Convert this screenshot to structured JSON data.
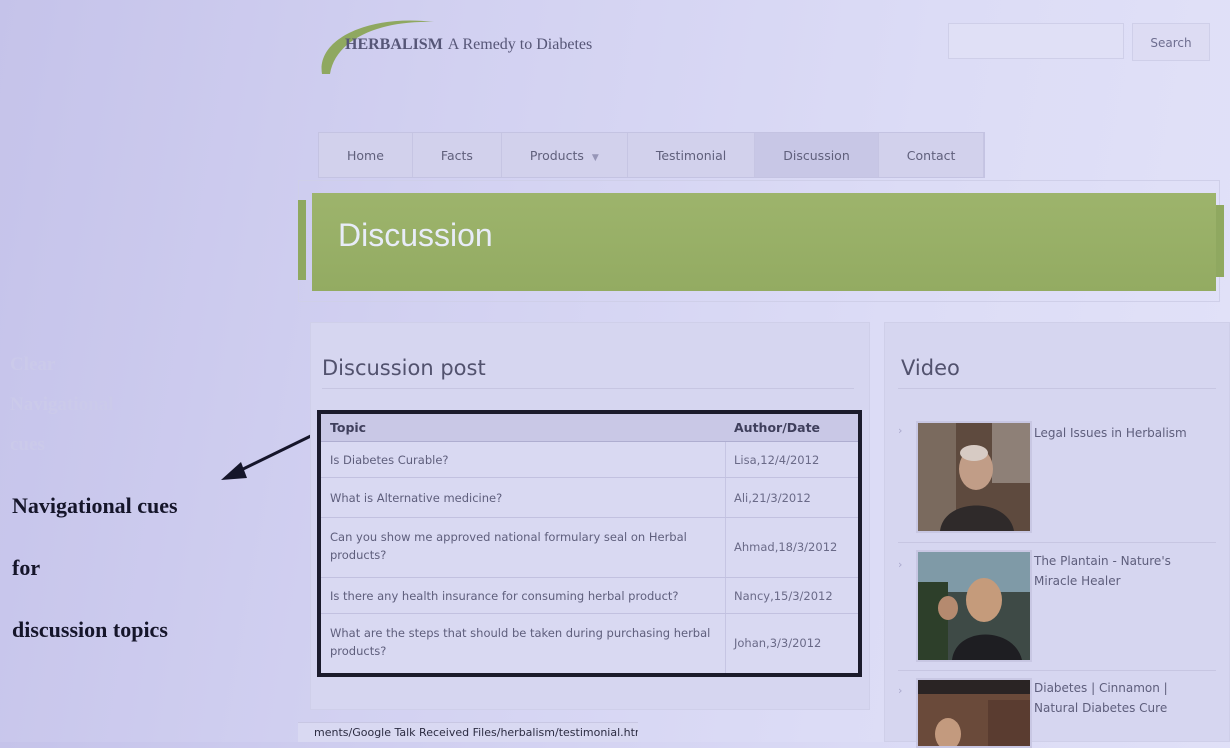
{
  "annotation": {
    "faint_lines": [
      "Clear",
      "Navigational",
      "cues"
    ],
    "cue_lines": [
      "Navigational cues",
      "for",
      "discussion topics"
    ]
  },
  "site": {
    "brand_name": "HERBALISM",
    "brand_tagline": "A Remedy to Diabetes",
    "search": {
      "placeholder": "",
      "button_label": "Search"
    },
    "nav": {
      "items": [
        {
          "label": "Home"
        },
        {
          "label": "Facts"
        },
        {
          "label": "Products"
        },
        {
          "label": "Testimonial"
        },
        {
          "label": "Discussion"
        },
        {
          "label": "Contact"
        }
      ]
    },
    "banner_title": "Discussion",
    "main": {
      "heading": "Discussion post",
      "table": {
        "headers": {
          "topic": "Topic",
          "author": "Author/Date"
        },
        "rows": [
          {
            "topic": "Is Diabetes Curable?",
            "author": "Lisa,12/4/2012"
          },
          {
            "topic": "What is Alternative medicine?",
            "author": "Ali,21/3/2012"
          },
          {
            "topic": "Can you show me approved national formulary seal on Herbal products?",
            "author": "Ahmad,18/3/2012"
          },
          {
            "topic": "Is there any health insurance for consuming herbal product?",
            "author": "Nancy,15/3/2012"
          },
          {
            "topic": "What are the steps that should be taken during purchasing herbal products?",
            "author": "Johan,3/3/2012"
          }
        ]
      }
    },
    "sidebar": {
      "heading": "Video",
      "videos": [
        {
          "title": "Legal Issues in Herbalism"
        },
        {
          "title": "The Plantain - Nature's Miracle Healer"
        },
        {
          "title": "Diabetes | Cinnamon | Natural Diabetes Cure"
        }
      ]
    },
    "status_bar": "ments/Google Talk Received Files/herbalism/testimonial.html"
  },
  "colors": {
    "banner_green": "#9db46c",
    "highlight_border": "#1b1b2b",
    "page_tint": "#d2d1f1"
  }
}
